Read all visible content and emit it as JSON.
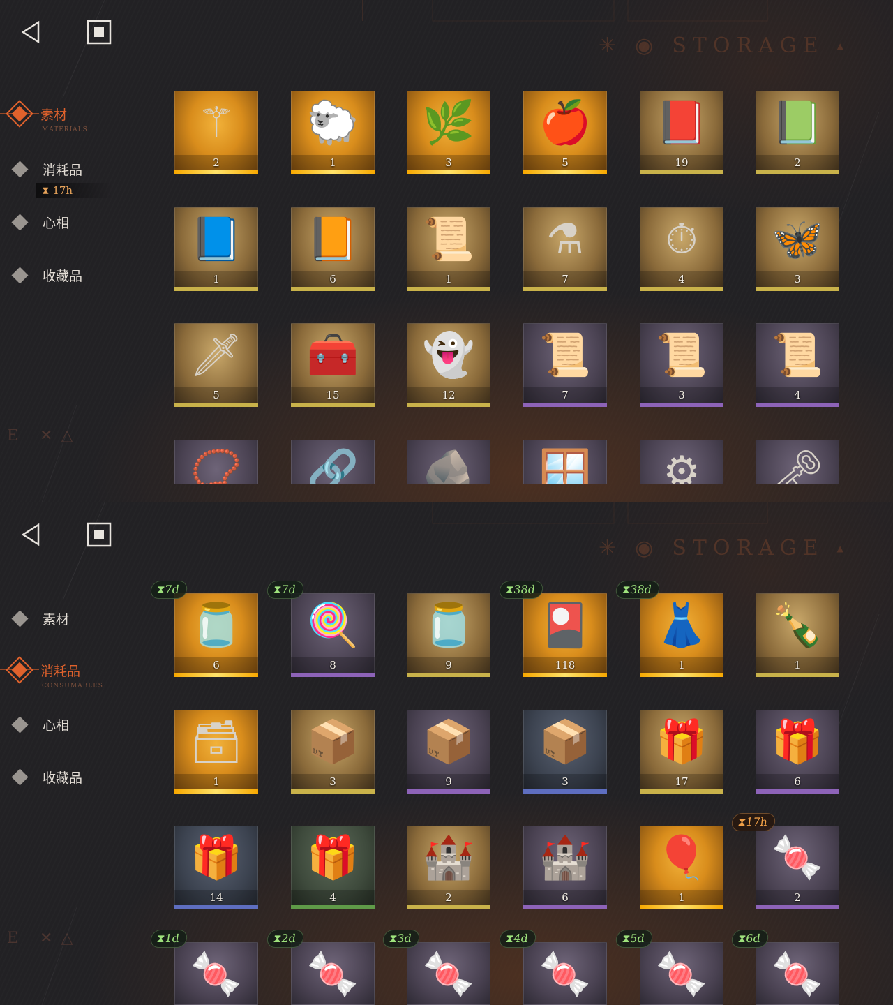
{
  "screens": [
    {
      "storage_title": "STORAGE",
      "nav": [
        {
          "label": "素材",
          "sub": "MATERIALS",
          "active": true
        },
        {
          "label": "消耗品",
          "sub": "CONSUMABLES",
          "active": false
        },
        {
          "label": "心相",
          "sub": "",
          "active": false
        },
        {
          "label": "收藏品",
          "sub": "",
          "active": false
        }
      ],
      "timer_tag": "17h",
      "items": [
        {
          "icon": "caduceus-icon",
          "glyph": "⚚",
          "qty": "2",
          "rarity": "gold"
        },
        {
          "icon": "sheep-icon",
          "glyph": "🐑",
          "qty": "1",
          "rarity": "gold"
        },
        {
          "icon": "laurel-wreath-icon",
          "glyph": "🌿",
          "qty": "3",
          "rarity": "gold"
        },
        {
          "icon": "apple-snake-icon",
          "glyph": "🍎",
          "qty": "5",
          "rarity": "gold"
        },
        {
          "icon": "red-spellbook-icon",
          "glyph": "📕",
          "qty": "19",
          "rarity": "gold2"
        },
        {
          "icon": "green-spellbook-icon",
          "glyph": "📗",
          "qty": "2",
          "rarity": "gold2"
        },
        {
          "icon": "blue-spellbook-icon",
          "glyph": "📘",
          "qty": "1",
          "rarity": "gold2"
        },
        {
          "icon": "gold-spellbook-icon",
          "glyph": "📙",
          "qty": "6",
          "rarity": "gold2"
        },
        {
          "icon": "green-tablet-icon",
          "glyph": "📜",
          "qty": "1",
          "rarity": "gold2"
        },
        {
          "icon": "potion-bottle-icon",
          "glyph": "⚗",
          "qty": "7",
          "rarity": "gold2"
        },
        {
          "icon": "pocket-watch-icon",
          "glyph": "⏱",
          "qty": "4",
          "rarity": "gold2"
        },
        {
          "icon": "firefly-icon",
          "glyph": "🦋",
          "qty": "3",
          "rarity": "gold2"
        },
        {
          "icon": "silver-bullets-icon",
          "glyph": "🗡",
          "qty": "5",
          "rarity": "gold2"
        },
        {
          "icon": "hand-box-icon",
          "glyph": "🧰",
          "qty": "15",
          "rarity": "gold2"
        },
        {
          "icon": "ghost-icon",
          "glyph": "👻",
          "qty": "12",
          "rarity": "gold2"
        },
        {
          "icon": "red-scroll-icon",
          "glyph": "📜",
          "qty": "7",
          "rarity": "purple"
        },
        {
          "icon": "blue-scroll-icon",
          "glyph": "📜",
          "qty": "3",
          "rarity": "purple"
        },
        {
          "icon": "gold-scroll-icon",
          "glyph": "📜",
          "qty": "4",
          "rarity": "purple"
        },
        {
          "icon": "amulet-icon",
          "glyph": "📿",
          "qty": "",
          "rarity": "purple"
        },
        {
          "icon": "chain-whistle-icon",
          "glyph": "🔗",
          "qty": "",
          "rarity": "purple"
        },
        {
          "icon": "stone-carving-icon",
          "glyph": "🪨",
          "qty": "",
          "rarity": "purple"
        },
        {
          "icon": "window-frame-icon",
          "glyph": "🪟",
          "qty": "",
          "rarity": "purple"
        },
        {
          "icon": "brass-device-icon",
          "glyph": "⚙",
          "qty": "",
          "rarity": "purple"
        },
        {
          "icon": "winged-key-icon",
          "glyph": "🗝",
          "qty": "",
          "rarity": "purple"
        }
      ]
    },
    {
      "storage_title": "STORAGE",
      "nav": [
        {
          "label": "素材",
          "sub": "",
          "active": false
        },
        {
          "label": "消耗品",
          "sub": "CONSUMABLES",
          "active": true
        },
        {
          "label": "心相",
          "sub": "",
          "active": false
        },
        {
          "label": "收藏品",
          "sub": "",
          "active": false
        }
      ],
      "items": [
        {
          "icon": "candy-jar-icon",
          "glyph": "🫙",
          "qty": "6",
          "rarity": "gold",
          "badge": "7d"
        },
        {
          "icon": "lollipop-icon",
          "glyph": "🍭",
          "qty": "8",
          "rarity": "purple",
          "badge": "7d"
        },
        {
          "icon": "candy-jar-icon",
          "glyph": "🫙",
          "qty": "9",
          "rarity": "gold2"
        },
        {
          "icon": "red-card-pack-icon",
          "glyph": "🎴",
          "qty": "118",
          "rarity": "gold",
          "badge": "38d"
        },
        {
          "icon": "mannequin-icon",
          "glyph": "👗",
          "qty": "1",
          "rarity": "gold",
          "badge": "38d"
        },
        {
          "icon": "message-bottle-icon",
          "glyph": "🍾",
          "qty": "1",
          "rarity": "gold2"
        },
        {
          "icon": "rune-chest-icon",
          "glyph": "🗃",
          "qty": "1",
          "rarity": "gold"
        },
        {
          "icon": "wooden-crate-icon",
          "glyph": "📦",
          "qty": "3",
          "rarity": "gold2"
        },
        {
          "icon": "wooden-crate-icon",
          "glyph": "📦",
          "qty": "9",
          "rarity": "purple"
        },
        {
          "icon": "wooden-crate-icon",
          "glyph": "📦",
          "qty": "3",
          "rarity": "blue"
        },
        {
          "icon": "parcel-icon",
          "glyph": "🎁",
          "qty": "17",
          "rarity": "gold2"
        },
        {
          "icon": "parcel-icon",
          "glyph": "🎁",
          "qty": "6",
          "rarity": "purple"
        },
        {
          "icon": "parcel-icon",
          "glyph": "🎁",
          "qty": "14",
          "rarity": "blue"
        },
        {
          "icon": "parcel-icon",
          "glyph": "🎁",
          "qty": "4",
          "rarity": "green"
        },
        {
          "icon": "sand-castle-icon",
          "glyph": "🏰",
          "qty": "2",
          "rarity": "gold2"
        },
        {
          "icon": "sand-castle-icon",
          "glyph": "🏰",
          "qty": "6",
          "rarity": "purple"
        },
        {
          "icon": "hot-air-balloon-icon",
          "glyph": "🎈",
          "qty": "1",
          "rarity": "gold"
        },
        {
          "icon": "wrapped-candy-icon",
          "glyph": "🍬",
          "qty": "2",
          "rarity": "purple",
          "badge": "17h",
          "badge_style": "orange"
        },
        {
          "icon": "wrapped-candy-icon",
          "glyph": "🍬",
          "qty": "",
          "rarity": "purple",
          "badge": "1d"
        },
        {
          "icon": "wrapped-candy-icon",
          "glyph": "🍬",
          "qty": "",
          "rarity": "purple",
          "badge": "2d"
        },
        {
          "icon": "wrapped-candy-icon",
          "glyph": "🍬",
          "qty": "",
          "rarity": "purple",
          "badge": "3d"
        },
        {
          "icon": "wrapped-candy-icon",
          "glyph": "🍬",
          "qty": "",
          "rarity": "purple",
          "badge": "4d"
        },
        {
          "icon": "wrapped-candy-icon",
          "glyph": "🍬",
          "qty": "",
          "rarity": "purple",
          "badge": "5d"
        },
        {
          "icon": "wrapped-candy-icon",
          "glyph": "🍬",
          "qty": "",
          "rarity": "purple",
          "badge": "6d"
        }
      ]
    }
  ],
  "colors": {
    "accent": "#e0622c",
    "timer_green": "#9ee27c",
    "timer_orange": "#f0a048"
  }
}
